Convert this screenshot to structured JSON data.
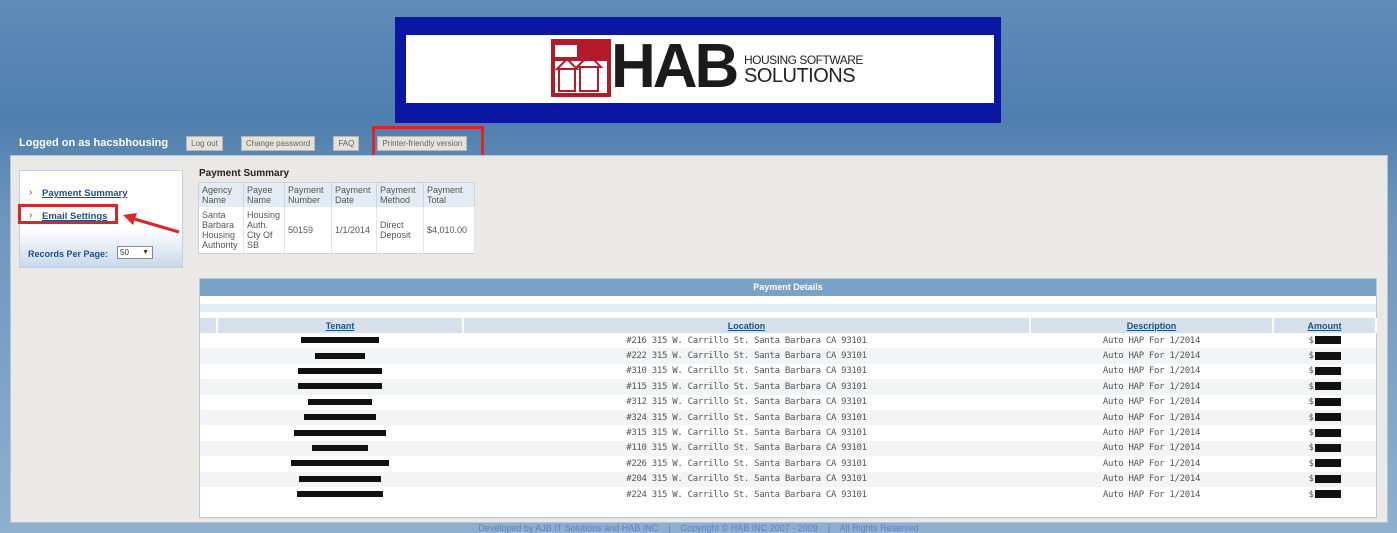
{
  "logo": {
    "mark": "HAB",
    "sub1": "HOUSING SOFTWARE",
    "sub2": "SOLUTIONS"
  },
  "topbar": {
    "logged_in": "Logged on as hacsbhousing",
    "buttons": [
      "Log out",
      "Change password",
      "FAQ",
      "Printer-friendly version"
    ]
  },
  "sidebar": {
    "payment_summary": "Payment Summary",
    "email_settings": "Email Settings",
    "records_label": "Records Per Page:",
    "records_value": "50"
  },
  "summary": {
    "title": "Payment Summary",
    "headers": [
      "Agency Name",
      "Payee Name",
      "Payment Number",
      "Payment Date",
      "Payment Method",
      "Payment Total"
    ],
    "row": [
      "Santa Barbara Housing Authority",
      "Housing Auth. Cty Of SB",
      "50159",
      "1/1/2014",
      "Direct Deposit",
      "$4,010.00"
    ]
  },
  "details": {
    "title": "Payment Details",
    "headers": [
      "Tenant",
      "Location",
      "Description",
      "Amount"
    ],
    "rows": [
      {
        "location": "#216 315 W. Carrillo St. Santa Barbara CA 93101",
        "description": "Auto HAP For 1/2014",
        "amount_prefix": "$"
      },
      {
        "location": "#222 315 W. Carrillo St. Santa Barbara CA 93101",
        "description": "Auto HAP For 1/2014",
        "amount_prefix": "$"
      },
      {
        "location": "#310 315 W. Carrillo St. Santa Barbara CA 93101",
        "description": "Auto HAP For 1/2014",
        "amount_prefix": "$"
      },
      {
        "location": "#115 315 W. Carrillo St. Santa Barbara CA 93101",
        "description": "Auto HAP For 1/2014",
        "amount_prefix": "$"
      },
      {
        "location": "#312 315 W. Carrillo St. Santa Barbara CA 93101",
        "description": "Auto HAP For 1/2014",
        "amount_prefix": "$"
      },
      {
        "location": "#324 315 W. Carrillo St. Santa Barbara CA 93101",
        "description": "Auto HAP For 1/2014",
        "amount_prefix": "$"
      },
      {
        "location": "#315 315 W. Carrillo St. Santa Barbara CA 93101",
        "description": "Auto HAP For 1/2014",
        "amount_prefix": "$"
      },
      {
        "location": "#110 315 W. Carrillo St. Santa Barbara CA 93101",
        "description": "Auto HAP For 1/2014",
        "amount_prefix": "$"
      },
      {
        "location": "#226 315 W. Carrillo St. Santa Barbara CA 93101",
        "description": "Auto HAP For 1/2014",
        "amount_prefix": "$"
      },
      {
        "location": "#204 315 W. Carrillo St. Santa Barbara CA 93101",
        "description": "Auto HAP For 1/2014",
        "amount_prefix": "$"
      },
      {
        "location": "#224 315 W. Carrillo St. Santa Barbara CA 93101",
        "description": "Auto HAP For 1/2014",
        "amount_prefix": "$"
      }
    ]
  },
  "footer": "Developed by AJB IT Solutions and HAB INC    |    Copyright © HAB INC 2007 - 2009    |    All Rights Reserved",
  "colors": {
    "accent_red": "#d8262a",
    "logo_blue": "#0a17a3",
    "link_blue": "#1e4e8c"
  }
}
